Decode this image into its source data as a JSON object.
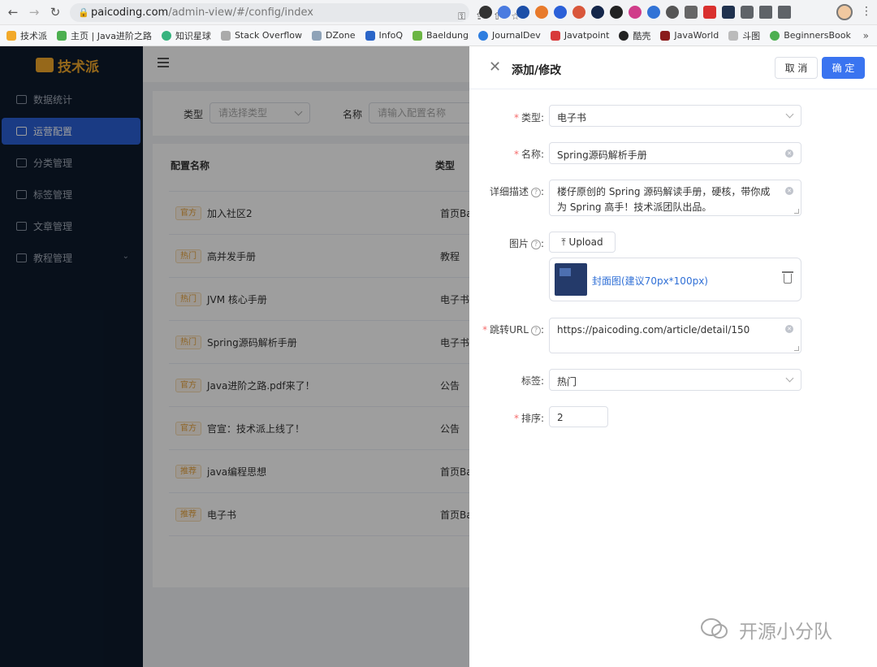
{
  "browser": {
    "url_host": "paicoding.com",
    "url_path": "/admin-view/#/config/index",
    "bookmarks": [
      "技术派",
      "主页 | Java进阶之路",
      "知识星球",
      "Stack Overflow",
      "DZone",
      "InfoQ",
      "Baeldung",
      "JournalDev",
      "Javatpoint",
      "酷壳",
      "JavaWorld",
      "斗图",
      "BeginnersBook"
    ]
  },
  "sidebar": {
    "logo_text": "技术派",
    "items": [
      {
        "label": "数据统计"
      },
      {
        "label": "运营配置"
      },
      {
        "label": "分类管理"
      },
      {
        "label": "标签管理"
      },
      {
        "label": "文章管理"
      },
      {
        "label": "教程管理"
      }
    ]
  },
  "filter": {
    "type_label": "类型",
    "type_placeholder": "请选择类型",
    "name_label": "名称",
    "name_placeholder": "请输入配置名称"
  },
  "table": {
    "headers": [
      "配置名称",
      "类型"
    ],
    "rows": [
      {
        "tag": "官方",
        "name": "加入社区2",
        "type": "首页Ba"
      },
      {
        "tag": "热门",
        "name": "高并发手册",
        "type": "教程"
      },
      {
        "tag": "热门",
        "name": "JVM 核心手册",
        "type": "电子书"
      },
      {
        "tag": "热门",
        "name": "Spring源码解析手册",
        "type": "电子书"
      },
      {
        "tag": "官方",
        "name": "Java进阶之路.pdf来了！",
        "type": "公告"
      },
      {
        "tag": "官方",
        "name": "官宣：技术派上线了！",
        "type": "公告"
      },
      {
        "tag": "推荐",
        "name": "java编程思想",
        "type": "首页Ba"
      },
      {
        "tag": "推荐",
        "name": "电子书",
        "type": "首页Ba"
      }
    ]
  },
  "drawer": {
    "title": "添加/修改",
    "cancel_label": "取 消",
    "ok_label": "确 定",
    "fields": {
      "type": {
        "label": "类型",
        "value": "电子书"
      },
      "name": {
        "label": "名称",
        "value": "Spring源码解析手册"
      },
      "desc": {
        "label": "详细描述",
        "value": "楼仔原创的 Spring 源码解读手册，硬核，带你成为 Spring 高手！技术派团队出品。"
      },
      "image": {
        "label": "图片",
        "upload_label": "Upload",
        "file_name": "封面图(建议70px*100px)"
      },
      "url": {
        "label": "跳转URL",
        "value": "https://paicoding.com/article/detail/150"
      },
      "tag": {
        "label": "标签",
        "value": "热门"
      },
      "sort": {
        "label": "排序",
        "value": "2"
      }
    },
    "label_suffix": ":",
    "required_mark": "*",
    "help_mark": "?"
  },
  "watermark": "开源小分队",
  "colors": {
    "primary": "#3a74f0",
    "sidebar_bg": "#0d1b2d",
    "tag_orange": "#e6a23c",
    "required_red": "#f56c6c"
  }
}
